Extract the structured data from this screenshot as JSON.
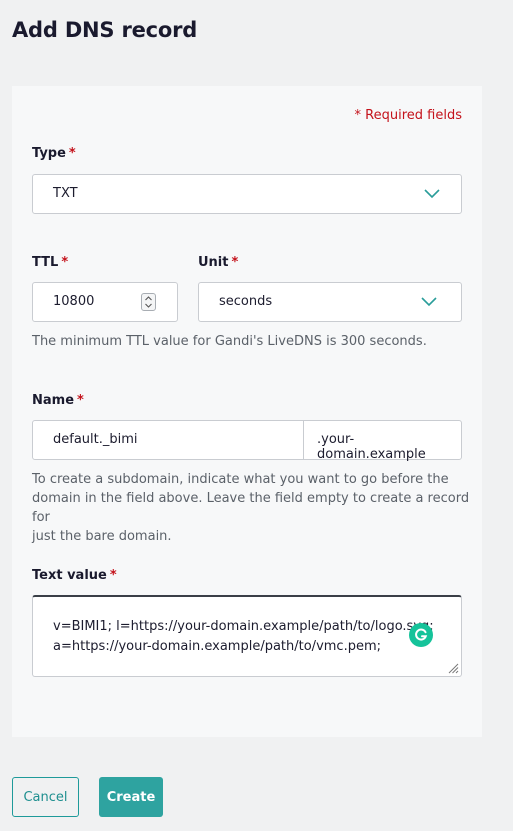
{
  "page": {
    "title": "Add DNS record"
  },
  "form": {
    "required_note": "* Required fields",
    "type": {
      "label": "Type",
      "required_mark": "*",
      "value": "TXT"
    },
    "ttl": {
      "label": "TTL",
      "required_mark": "*",
      "value": "10800",
      "hint": "The minimum TTL value for Gandi's LiveDNS is 300 seconds."
    },
    "unit": {
      "label": "Unit",
      "required_mark": "*",
      "value": "seconds"
    },
    "name": {
      "label": "Name",
      "required_mark": "*",
      "value": "default._bimi",
      "suffix": ".your-domain.example",
      "hint_lines": [
        "To create a subdomain, indicate what you want to go before the",
        "domain in the field above. Leave the field empty to create a record for",
        "just the bare domain."
      ]
    },
    "text_value": {
      "label": "Text value",
      "required_mark": "*",
      "lines": [
        "v=BIMI1; l=https://your-domain.example/path/to/logo.svg;",
        "a=https://your-domain.example/path/to/vmc.pem;"
      ],
      "assistant_icon": "grammarly-icon"
    }
  },
  "actions": {
    "cancel_label": "Cancel",
    "create_label": "Create"
  },
  "colors": {
    "accent": "#2ea3a0",
    "required": "#c4121b",
    "grammarly": "#15c39a"
  }
}
